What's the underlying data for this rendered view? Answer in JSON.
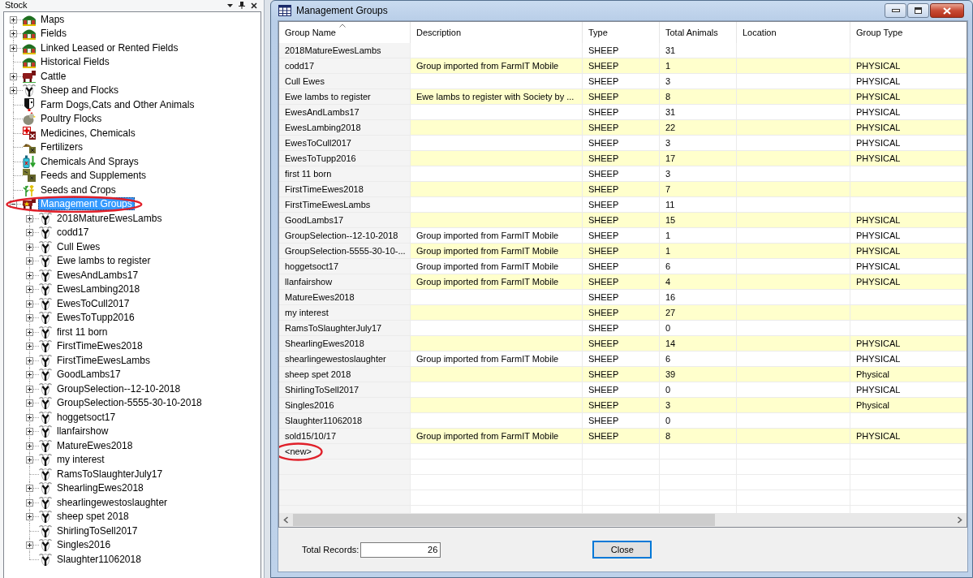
{
  "stock_panel": {
    "title": "Stock",
    "tree": [
      {
        "label": "Maps",
        "kind": "field",
        "expandable": true,
        "expanded": false,
        "selected": false,
        "circled": false
      },
      {
        "label": "Fields",
        "kind": "field",
        "expandable": true,
        "expanded": false,
        "selected": false,
        "circled": false
      },
      {
        "label": "Linked Leased or Rented Fields",
        "kind": "field",
        "expandable": true,
        "expanded": false,
        "selected": false,
        "circled": false
      },
      {
        "label": "Historical Fields",
        "kind": "field",
        "expandable": false,
        "expanded": false,
        "selected": false,
        "circled": false
      },
      {
        "label": "Cattle",
        "kind": "cattle",
        "expandable": true,
        "expanded": false,
        "selected": false,
        "circled": false
      },
      {
        "label": "Sheep and Flocks",
        "kind": "sheep",
        "expandable": true,
        "expanded": false,
        "selected": false,
        "circled": false
      },
      {
        "label": "Farm Dogs,Cats and Other Animals",
        "kind": "dog",
        "expandable": false,
        "expanded": false,
        "selected": false,
        "circled": false
      },
      {
        "label": "Poultry Flocks",
        "kind": "poultry",
        "expandable": false,
        "expanded": false,
        "selected": false,
        "circled": false
      },
      {
        "label": "Medicines, Chemicals",
        "kind": "medicine",
        "expandable": false,
        "expanded": false,
        "selected": false,
        "circled": false
      },
      {
        "label": "Fertilizers",
        "kind": "fertilizer",
        "expandable": false,
        "expanded": false,
        "selected": false,
        "circled": false
      },
      {
        "label": "Chemicals And Sprays",
        "kind": "chemicals",
        "expandable": false,
        "expanded": false,
        "selected": false,
        "circled": false
      },
      {
        "label": "Feeds and Supplements",
        "kind": "feed",
        "expandable": false,
        "expanded": false,
        "selected": false,
        "circled": false
      },
      {
        "label": "Seeds and Crops",
        "kind": "seeds",
        "expandable": false,
        "expanded": false,
        "selected": false,
        "circled": false
      },
      {
        "label": "Management Groups",
        "kind": "group",
        "expandable": true,
        "expanded": true,
        "selected": true,
        "circled": true,
        "children": [
          {
            "label": "2018MatureEwesLambs",
            "kind": "sheep",
            "expandable": true,
            "expanded": false,
            "selected": false,
            "circled": false
          },
          {
            "label": "codd17",
            "kind": "sheep",
            "expandable": true,
            "expanded": false,
            "selected": false,
            "circled": false
          },
          {
            "label": "Cull Ewes",
            "kind": "sheep",
            "expandable": true,
            "expanded": false,
            "selected": false,
            "circled": false
          },
          {
            "label": "Ewe lambs to register",
            "kind": "sheep",
            "expandable": true,
            "expanded": false,
            "selected": false,
            "circled": false
          },
          {
            "label": "EwesAndLambs17",
            "kind": "sheep",
            "expandable": true,
            "expanded": false,
            "selected": false,
            "circled": false
          },
          {
            "label": "EwesLambing2018",
            "kind": "sheep",
            "expandable": true,
            "expanded": false,
            "selected": false,
            "circled": false
          },
          {
            "label": "EwesToCull2017",
            "kind": "sheep",
            "expandable": true,
            "expanded": false,
            "selected": false,
            "circled": false
          },
          {
            "label": "EwesToTupp2016",
            "kind": "sheep",
            "expandable": true,
            "expanded": false,
            "selected": false,
            "circled": false
          },
          {
            "label": "first 11 born",
            "kind": "sheep",
            "expandable": true,
            "expanded": false,
            "selected": false,
            "circled": false
          },
          {
            "label": "FirstTimeEwes2018",
            "kind": "sheep",
            "expandable": true,
            "expanded": false,
            "selected": false,
            "circled": false
          },
          {
            "label": "FirstTimeEwesLambs",
            "kind": "sheep",
            "expandable": true,
            "expanded": false,
            "selected": false,
            "circled": false
          },
          {
            "label": "GoodLambs17",
            "kind": "sheep",
            "expandable": true,
            "expanded": false,
            "selected": false,
            "circled": false
          },
          {
            "label": "GroupSelection--12-10-2018",
            "kind": "sheep",
            "expandable": true,
            "expanded": false,
            "selected": false,
            "circled": false
          },
          {
            "label": "GroupSelection-5555-30-10-2018",
            "kind": "sheep",
            "expandable": true,
            "expanded": false,
            "selected": false,
            "circled": false
          },
          {
            "label": "hoggetsoct17",
            "kind": "sheep",
            "expandable": true,
            "expanded": false,
            "selected": false,
            "circled": false
          },
          {
            "label": "llanfairshow",
            "kind": "sheep",
            "expandable": true,
            "expanded": false,
            "selected": false,
            "circled": false
          },
          {
            "label": "MatureEwes2018",
            "kind": "sheep",
            "expandable": true,
            "expanded": false,
            "selected": false,
            "circled": false
          },
          {
            "label": "my interest",
            "kind": "sheep",
            "expandable": true,
            "expanded": false,
            "selected": false,
            "circled": false
          },
          {
            "label": "RamsToSlaughterJuly17",
            "kind": "sheep",
            "expandable": false,
            "expanded": false,
            "selected": false,
            "circled": false
          },
          {
            "label": "ShearlingEwes2018",
            "kind": "sheep",
            "expandable": true,
            "expanded": false,
            "selected": false,
            "circled": false
          },
          {
            "label": "shearlingewestoslaughter",
            "kind": "sheep",
            "expandable": true,
            "expanded": false,
            "selected": false,
            "circled": false
          },
          {
            "label": "sheep spet 2018",
            "kind": "sheep",
            "expandable": true,
            "expanded": false,
            "selected": false,
            "circled": false
          },
          {
            "label": "ShirlingToSell2017",
            "kind": "sheep",
            "expandable": false,
            "expanded": false,
            "selected": false,
            "circled": false
          },
          {
            "label": "Singles2016",
            "kind": "sheep",
            "expandable": true,
            "expanded": false,
            "selected": false,
            "circled": false
          },
          {
            "label": "Slaughter11062018",
            "kind": "sheep",
            "expandable": false,
            "expanded": false,
            "selected": false,
            "circled": false
          }
        ]
      }
    ]
  },
  "window": {
    "title": "Management Groups"
  },
  "table": {
    "columns": [
      {
        "label": "Group Name",
        "sorted": true
      },
      {
        "label": "Description",
        "sorted": false
      },
      {
        "label": "Type",
        "sorted": false
      },
      {
        "label": "Total Animals",
        "sorted": false
      },
      {
        "label": "Location",
        "sorted": false
      },
      {
        "label": "Group Type",
        "sorted": false
      }
    ],
    "rows": [
      {
        "group_name": "2018MatureEwesLambs",
        "type": "SHEEP",
        "total_animals": "31"
      },
      {
        "group_name": "codd17",
        "description": "Group imported from FarmIT Mobile",
        "type": "SHEEP",
        "total_animals": "1",
        "group_type": "PHYSICAL"
      },
      {
        "group_name": "Cull Ewes",
        "type": "SHEEP",
        "total_animals": "3",
        "group_type": "PHYSICAL"
      },
      {
        "group_name": "Ewe lambs to register",
        "description": "Ewe lambs to register with Society by ...",
        "type": "SHEEP",
        "total_animals": "8",
        "group_type": "PHYSICAL"
      },
      {
        "group_name": "EwesAndLambs17",
        "type": "SHEEP",
        "total_animals": "31",
        "group_type": "PHYSICAL"
      },
      {
        "group_name": "EwesLambing2018",
        "type": "SHEEP",
        "total_animals": "22",
        "group_type": "PHYSICAL"
      },
      {
        "group_name": "EwesToCull2017",
        "type": "SHEEP",
        "total_animals": "3",
        "group_type": "PHYSICAL"
      },
      {
        "group_name": "EwesToTupp2016",
        "type": "SHEEP",
        "total_animals": "17",
        "group_type": "PHYSICAL"
      },
      {
        "group_name": "first 11 born",
        "type": "SHEEP",
        "total_animals": "3"
      },
      {
        "group_name": "FirstTimeEwes2018",
        "type": "SHEEP",
        "total_animals": "7"
      },
      {
        "group_name": "FirstTimeEwesLambs",
        "type": "SHEEP",
        "total_animals": "11"
      },
      {
        "group_name": "GoodLambs17",
        "type": "SHEEP",
        "total_animals": "15",
        "group_type": "PHYSICAL"
      },
      {
        "group_name": "GroupSelection--12-10-2018",
        "description": "Group imported from FarmIT Mobile",
        "type": "SHEEP",
        "total_animals": "1",
        "group_type": "PHYSICAL"
      },
      {
        "group_name": "GroupSelection-5555-30-10-...",
        "description": "Group imported from FarmIT Mobile",
        "type": "SHEEP",
        "total_animals": "1",
        "group_type": "PHYSICAL"
      },
      {
        "group_name": "hoggetsoct17",
        "description": "Group imported from FarmIT Mobile",
        "type": "SHEEP",
        "total_animals": "6",
        "group_type": "PHYSICAL"
      },
      {
        "group_name": "llanfairshow",
        "description": "Group imported from FarmIT Mobile",
        "type": "SHEEP",
        "total_animals": "4",
        "group_type": "PHYSICAL"
      },
      {
        "group_name": "MatureEwes2018",
        "type": "SHEEP",
        "total_animals": "16"
      },
      {
        "group_name": "my interest",
        "type": "SHEEP",
        "total_animals": "27"
      },
      {
        "group_name": "RamsToSlaughterJuly17",
        "type": "SHEEP",
        "total_animals": "0"
      },
      {
        "group_name": "ShearlingEwes2018",
        "type": "SHEEP",
        "total_animals": "14",
        "group_type": "PHYSICAL"
      },
      {
        "group_name": "shearlingewestoslaughter",
        "description": "Group imported from FarmIT Mobile",
        "type": "SHEEP",
        "total_animals": "6",
        "group_type": "PHYSICAL"
      },
      {
        "group_name": "sheep spet 2018",
        "type": "SHEEP",
        "total_animals": "39",
        "group_type": "Physical"
      },
      {
        "group_name": "ShirlingToSell2017",
        "type": "SHEEP",
        "total_animals": "0",
        "group_type": "PHYSICAL"
      },
      {
        "group_name": "Singles2016",
        "type": "SHEEP",
        "total_animals": "3",
        "group_type": "Physical"
      },
      {
        "group_name": "Slaughter11062018",
        "type": "SHEEP",
        "total_animals": "0"
      },
      {
        "group_name": "sold15/10/17",
        "description": "Group imported from FarmIT Mobile",
        "type": "SHEEP",
        "total_animals": "8",
        "group_type": "PHYSICAL"
      }
    ],
    "new_row": {
      "label": "<new>",
      "circled": true
    }
  },
  "footer": {
    "total_records_label": "Total Records:",
    "total_records": "26",
    "close_button": {
      "label": "Close",
      "focused": true
    }
  }
}
